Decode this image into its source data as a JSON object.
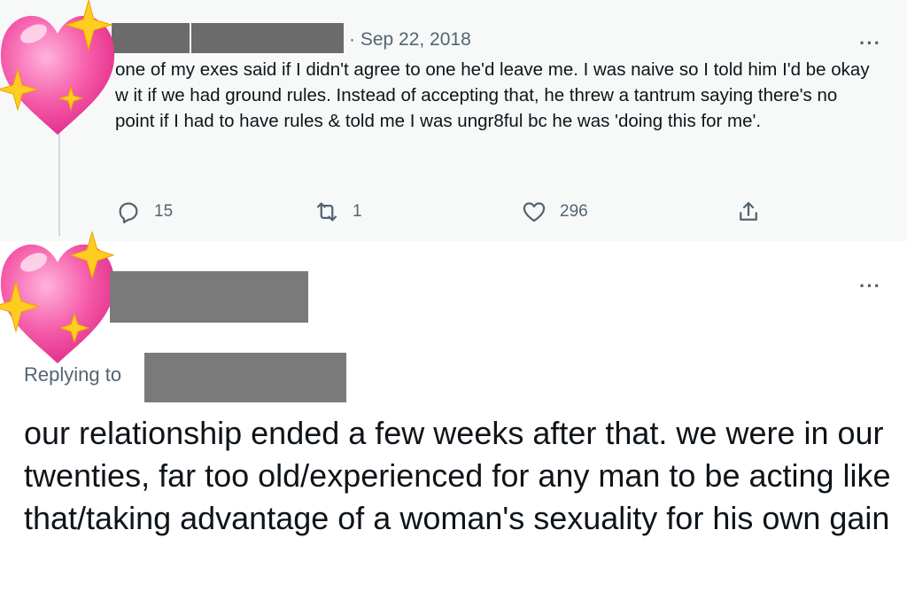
{
  "tweet": {
    "date": "· Sep 22, 2018",
    "more_label": "···",
    "text": "one of my exes said if I didn't agree to one he'd leave me. I was naive so I told him I'd be okay w it if we had ground rules. Instead of accepting that, he threw a tantrum saying there's no point if I had to have rules & told me I was ungr8ful bc he was 'doing this for me'.",
    "actions": {
      "reply_icon": "reply-icon",
      "replies": "15",
      "retweet_icon": "retweet-icon",
      "retweets": "1",
      "like_icon": "heart-icon",
      "likes": "296",
      "share_icon": "share-icon"
    }
  },
  "reply": {
    "more_label": "···",
    "replying_to": "Replying to",
    "text": "our relationship ended a few weeks after that. we were in our twenties, far too old/experienced for any man to be acting like that/taking advantage of a woman's sexuality for his own gain"
  },
  "avatars": {
    "icon": "sparkling-heart-icon"
  },
  "colors": {
    "muted": "#536471",
    "text": "#0f1419",
    "thread_bg": "#f7f9f9",
    "redaction": "#6b6b6b",
    "heart": "#f45aa8",
    "sparkle": "#ffcc22"
  }
}
